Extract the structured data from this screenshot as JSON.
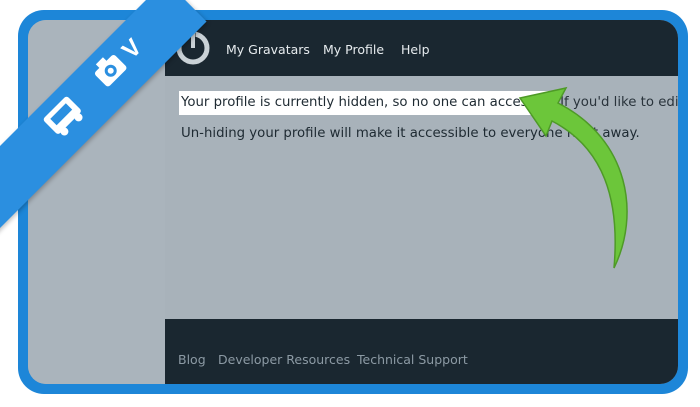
{
  "nav": {
    "items": [
      {
        "label": "My Gravatars"
      },
      {
        "label": "My Profile"
      },
      {
        "label": "Help"
      }
    ]
  },
  "content": {
    "highlighted_text": "Your profile is currently hidden, so no one can access it.",
    "line1_rest": " If you'd like to edit it, you",
    "line2": "Un-hiding your profile will make it accessible to everyone right away."
  },
  "footer": {
    "links": [
      {
        "label": "Blog"
      },
      {
        "label": "Developer Resources"
      },
      {
        "label": "Technical Support"
      }
    ]
  },
  "ribbon": {
    "icons": [
      "car-icon",
      "camera-icon",
      "v-letter-icon"
    ],
    "letter": "V"
  },
  "colors": {
    "frame_blue": "#1d86d8",
    "navbar": "#1a2730",
    "content_bg": "#a8b2ba",
    "arrow_green": "#6cc63a"
  }
}
